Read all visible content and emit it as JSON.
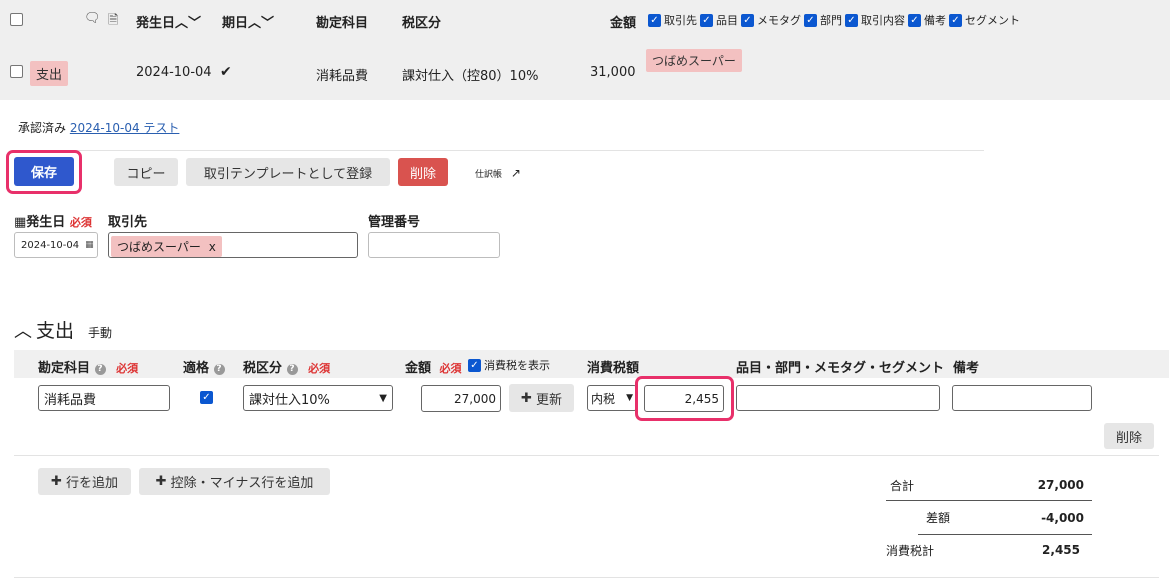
{
  "header_row": {
    "date_col": "発生日",
    "due_col": "期日",
    "account_col": "勘定科目",
    "tax_col": "税区分",
    "amount_col": "金額",
    "column_toggles": [
      "取引先",
      "品目",
      "メモタグ",
      "部門",
      "取引内容",
      "備考",
      "セグメント"
    ]
  },
  "data_row": {
    "type": "支出",
    "date": "2024-10-04",
    "check_mark": "✔",
    "account": "消耗品費",
    "tax": "課対仕入（控80）10%",
    "amount": "31,000",
    "partner": "つばめスーパー"
  },
  "approval": {
    "status": "承認済み",
    "link": "2024-10-04 テスト"
  },
  "actions": {
    "save": "保存",
    "copy": "コピー",
    "register_template": "取引テンプレートとして登録",
    "delete": "削除",
    "journal": "仕訳帳"
  },
  "form": {
    "issue_date_label": "発生日",
    "required": "必須",
    "issue_date_value": "2024-10-04",
    "partner_label": "取引先",
    "partner_tag": "つばめスーパー",
    "partner_tag_remove": "x",
    "manage_no_label": "管理番号"
  },
  "section": {
    "title": "支出",
    "mode": "手動"
  },
  "detail_header": {
    "account": "勘定科目",
    "eligible": "適格",
    "tax_class": "税区分",
    "amount": "金額",
    "show_tax": "消費税を表示",
    "tax_amount": "消費税額",
    "items": "品目・部門・メモタグ・セグメント",
    "memo": "備考"
  },
  "detail_row": {
    "account": "消耗品費",
    "tax_class": "課対仕入10%",
    "amount": "27,000",
    "update": "更新",
    "tax_mode": "内税",
    "tax_amount": "2,455",
    "delete": "削除"
  },
  "add_buttons": {
    "add_row": "行を追加",
    "add_deduction": "控除・マイナス行を追加"
  },
  "totals": {
    "total_label": "合計",
    "total_value": "27,000",
    "diff_label": "差額",
    "diff_value": "-4,000",
    "tax_label": "消費税計",
    "tax_value": "2,455"
  }
}
